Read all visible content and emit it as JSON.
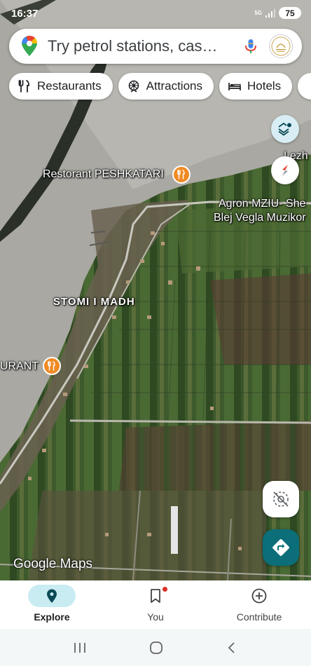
{
  "status_bar": {
    "time": "16:37",
    "network": "5G",
    "battery": "75"
  },
  "search": {
    "placeholder": "Try petrol stations, cas…"
  },
  "chips": [
    {
      "label": "Restaurants",
      "icon": "fork-knife-icon"
    },
    {
      "label": "Attractions",
      "icon": "attractions-icon"
    },
    {
      "label": "Hotels",
      "icon": "bed-icon"
    }
  ],
  "map": {
    "labels": {
      "restaurant_peshkatari": "Restorant PESHKATARI",
      "restaurant_partial": "URANT",
      "agron_mziu": "Agron MZIU- She",
      "blej_vegla": "Blej Vegla Muzikor",
      "lezh": "Lezh",
      "place": "STOMI I MADH"
    },
    "attribution": {
      "google": "Google",
      "maps": "Maps"
    }
  },
  "bottom_nav": [
    {
      "label": "Explore",
      "icon": "location-pin-icon",
      "active": true
    },
    {
      "label": "You",
      "icon": "bookmark-icon",
      "active": false
    },
    {
      "label": "Contribute",
      "icon": "add-circle-icon",
      "active": false
    }
  ],
  "colors": {
    "accent": "#0b6e78",
    "active_pill": "#c9ecf3",
    "poi": "#f08a24"
  }
}
